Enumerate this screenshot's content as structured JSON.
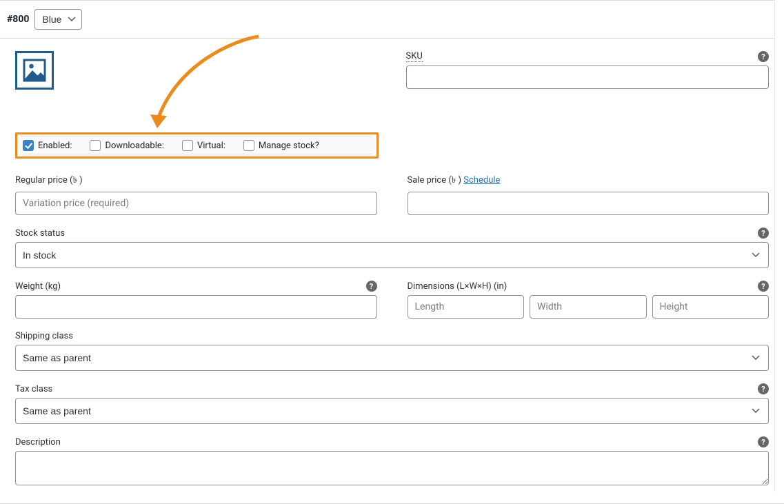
{
  "header": {
    "variation_id": "#800",
    "attribute_value": "Blue"
  },
  "checkboxes": {
    "enabled": {
      "label": "Enabled:",
      "checked": true
    },
    "downloadable": {
      "label": "Downloadable:",
      "checked": false
    },
    "virtual": {
      "label": "Virtual:",
      "checked": false
    },
    "manage_stock": {
      "label": "Manage stock?",
      "checked": false
    }
  },
  "fields": {
    "sku": {
      "label": "SKU",
      "value": ""
    },
    "regular_price": {
      "label": "Regular price (৳ )",
      "placeholder": "Variation price (required)",
      "value": ""
    },
    "sale_price": {
      "label": "Sale price (৳ )",
      "schedule_link": "Schedule",
      "value": ""
    },
    "stock_status": {
      "label": "Stock status",
      "value": "In stock"
    },
    "weight": {
      "label": "Weight (kg)",
      "value": ""
    },
    "dimensions": {
      "label": "Dimensions (L×W×H) (in)",
      "length_placeholder": "Length",
      "width_placeholder": "Width",
      "height_placeholder": "Height",
      "length": "",
      "width": "",
      "height": ""
    },
    "shipping_class": {
      "label": "Shipping class",
      "value": "Same as parent"
    },
    "tax_class": {
      "label": "Tax class",
      "value": "Same as parent"
    },
    "description": {
      "label": "Description",
      "value": ""
    }
  },
  "icons": {
    "help": "?"
  }
}
